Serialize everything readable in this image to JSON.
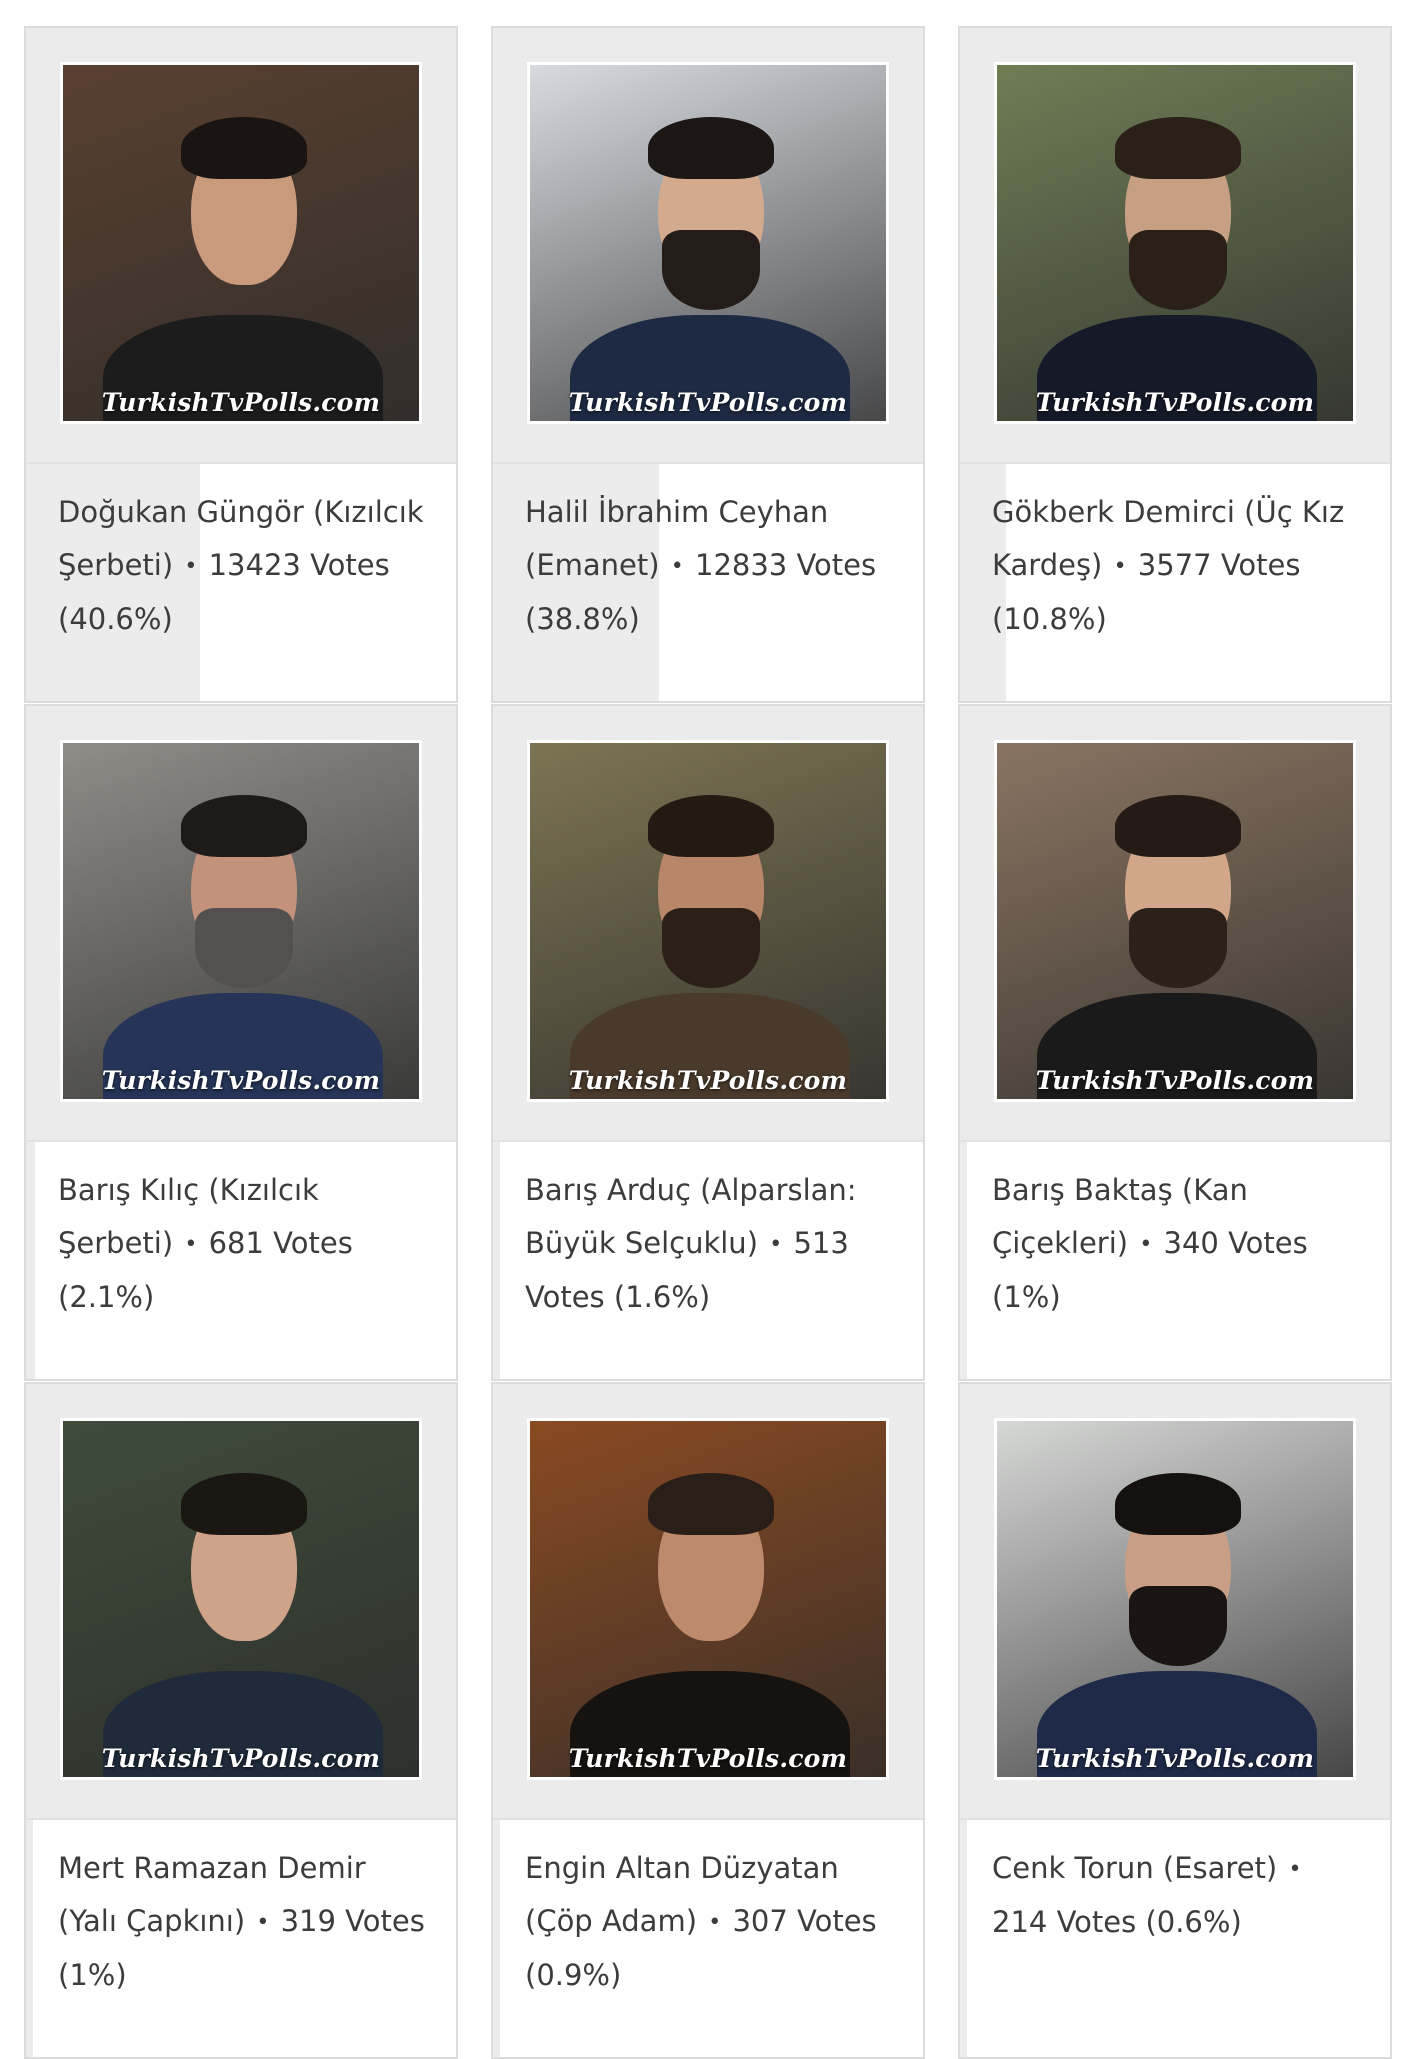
{
  "watermark": "TurkishTvPolls.com",
  "bullet": "•",
  "results": [
    {
      "name": "Doğukan Güngör (Kızılcık Şerbeti)",
      "votes": "13423 Votes",
      "percent": "(40.6%)",
      "share": 0.406,
      "photo": {
        "bg": "#5a4030",
        "skin": "#c99a7c",
        "hair": "#1a1512",
        "beard": "#2a201a",
        "shirt": "#1c1c1c",
        "beard_on": false
      }
    },
    {
      "name": "Halil İbrahim Ceyhan (Emanet)",
      "votes": "12833 Votes",
      "percent": "(38.8%)",
      "share": 0.388,
      "photo": {
        "bg": "#d7dbe0",
        "skin": "#d4aa8e",
        "hair": "#1c1714",
        "beard": "#241c18",
        "shirt": "#1e2a44",
        "beard_on": true
      }
    },
    {
      "name": "Gökberk Demirci (Üç Kız Kardeş)",
      "votes": "3577 Votes",
      "percent": "(10.8%)",
      "share": 0.108,
      "photo": {
        "bg": "#6f7d55",
        "skin": "#c79f82",
        "hair": "#2a2018",
        "beard": "#2a2018",
        "shirt": "#151a28",
        "beard_on": true
      }
    },
    {
      "name": "Barış Kılıç (Kızılcık Şerbeti)",
      "votes": "681 Votes",
      "percent": "(2.1%)",
      "share": 0.021,
      "photo": {
        "bg": "#8f8d88",
        "skin": "#c2937a",
        "hair": "#1d1a18",
        "beard": "#555050",
        "shirt": "#253457",
        "beard_on": true
      }
    },
    {
      "name": "Barış Arduç (Alparslan: Büyük Selçuklu)",
      "votes": "513 Votes",
      "percent": "(1.6%)",
      "share": 0.016,
      "photo": {
        "bg": "#7c7452",
        "skin": "#b8876a",
        "hair": "#231a14",
        "beard": "#2b1f18",
        "shirt": "#4a3a2c",
        "beard_on": true
      }
    },
    {
      "name": "Barış Baktaş (Kan Çiçekleri)",
      "votes": "340 Votes",
      "percent": "(1%)",
      "share": 0.01,
      "photo": {
        "bg": "#8a7460",
        "skin": "#d1a689",
        "hair": "#241b16",
        "beard": "#2b201a",
        "shirt": "#1a1a1a",
        "beard_on": true
      }
    },
    {
      "name": "Mert Ramazan Demir (Yalı Çapkını)",
      "votes": "319 Votes",
      "percent": "(1%)",
      "share": 0.01,
      "photo": {
        "bg": "#3f4c3a",
        "skin": "#cfa389",
        "hair": "#1a1612",
        "beard": "#3a2e26",
        "shirt": "#1f2b3a",
        "beard_on": false
      }
    },
    {
      "name": "Engin Altan Düzyatan (Çöp Adam)",
      "votes": "307 Votes",
      "percent": "(0.9%)",
      "share": 0.009,
      "photo": {
        "bg": "#8a4a22",
        "skin": "#bd8b6c",
        "hair": "#2a1f18",
        "beard": "#3a2b22",
        "shirt": "#161210",
        "beard_on": false
      }
    },
    {
      "name": "Cenk Torun (Esaret)",
      "votes": "214 Votes",
      "percent": "(0.6%)",
      "share": 0.006,
      "photo": {
        "bg": "#d6d8d6",
        "skin": "#c89f86",
        "hair": "#15110f",
        "beard": "#1a1512",
        "shirt": "#1f2a48",
        "beard_on": true
      }
    }
  ]
}
